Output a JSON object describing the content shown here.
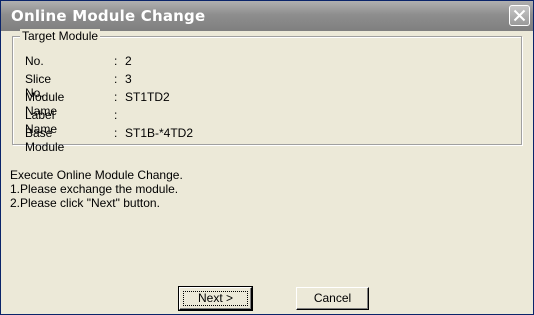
{
  "window": {
    "title": "Online Module Change"
  },
  "target_module": {
    "group_label": "Target Module",
    "fields": [
      {
        "label": "No.",
        "value": "2"
      },
      {
        "label": "Slice No.",
        "value": "3"
      },
      {
        "label": "Module Name",
        "value": "ST1TD2"
      },
      {
        "label": "Label Name",
        "value": ""
      },
      {
        "label": "Base Module",
        "value": "ST1B-*4TD2"
      }
    ],
    "colon": ":"
  },
  "instructions": [
    "Execute Online Module Change.",
    "1.Please exchange the module.",
    "2.Please click \"Next\" button."
  ],
  "buttons": {
    "next": "Next >",
    "cancel": "Cancel"
  },
  "icons": {
    "close": "close-icon"
  }
}
